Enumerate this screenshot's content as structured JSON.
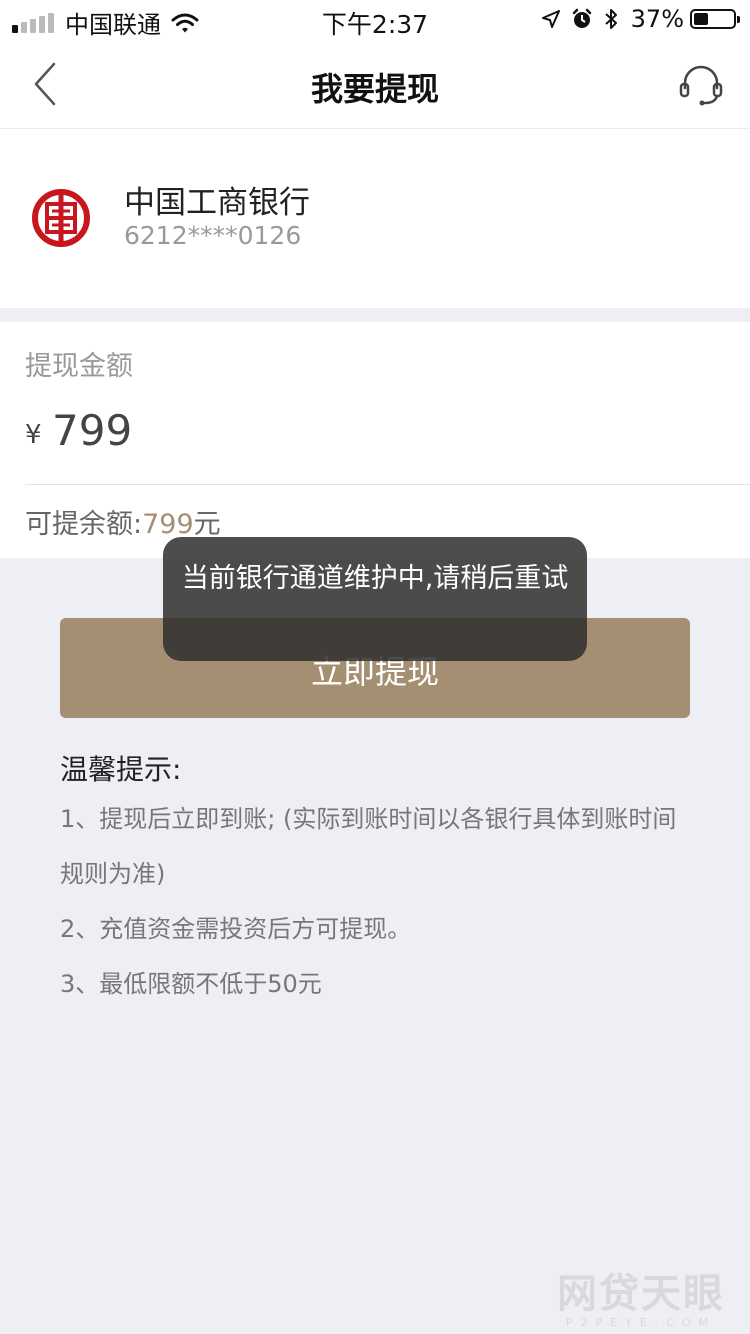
{
  "status_bar": {
    "carrier": "中国联通",
    "time": "下午2:37",
    "battery_pct": "37%",
    "battery_level": 0.37,
    "signal_bars_filled": 1,
    "icons": [
      "wifi-icon",
      "location-arrow-icon",
      "alarm-icon",
      "bluetooth-icon",
      "battery-icon"
    ]
  },
  "nav": {
    "title": "我要提现",
    "icons": [
      "chevron-left-icon",
      "headset-icon"
    ]
  },
  "bank": {
    "name": "中国工商银行",
    "card_number": "6212****0126",
    "logo_icon": "icbc-logo",
    "brand_color": "#c7161e"
  },
  "withdraw": {
    "amount_label": "提现金额",
    "currency_symbol": "¥",
    "amount": "799",
    "balance_label": "可提余额:",
    "balance_value": "799",
    "balance_unit": "元",
    "accent_color": "#a58f72"
  },
  "actions": {
    "withdraw_button": "立即提现"
  },
  "tips": {
    "title": "温馨提示:",
    "items": [
      "1、提现后立即到账; (实际到账时间以各银行具体到账时间规则为准)",
      "2、充值资金需投资后方可提现。",
      "3、最低限额不低于50元"
    ]
  },
  "toast": {
    "message": "当前银行通道维护中,请稍后重试"
  },
  "watermark": {
    "main": "网贷天眼",
    "sub": "P2PEYE.COM"
  }
}
